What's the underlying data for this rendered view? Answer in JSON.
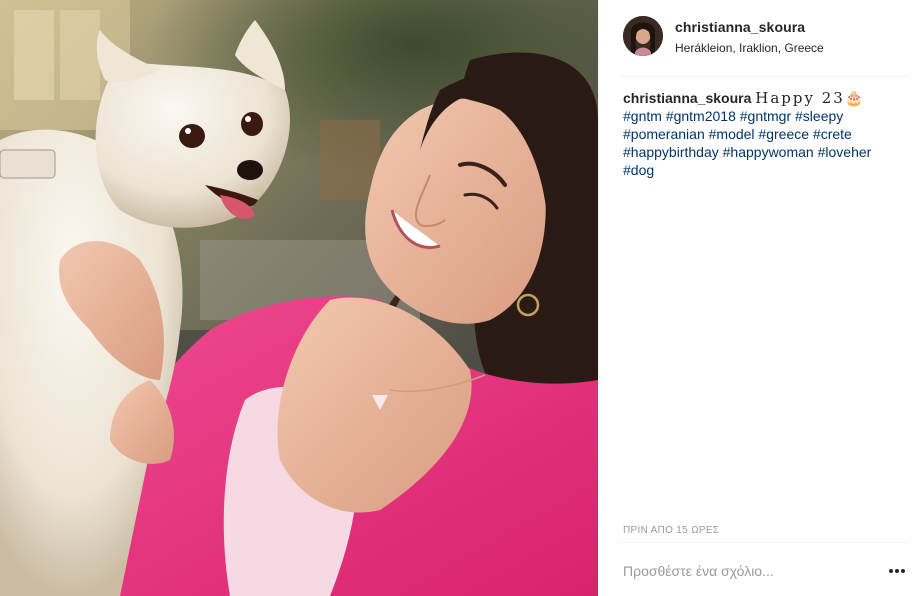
{
  "post": {
    "author": {
      "username": "christianna_skoura",
      "location": "Heráklеion, Iraklion, Greece"
    },
    "caption": {
      "username": "christianna_skoura",
      "text": "Happy 23🎂",
      "hashtags": [
        "#gntm",
        "#gntm2018",
        "#gntmgr",
        "#sleepy",
        "#pomeranian",
        "#model",
        "#greece",
        "#crete",
        "#happybirthday",
        "#happywoman",
        "#loveher",
        "#dog"
      ]
    },
    "timestamp": "ΠΡΙΝ ΑΠΟ 15 ΩΡΕΣ",
    "comment": {
      "placeholder": "Προσθέστε ένα σχόλιο...",
      "value": ""
    },
    "icons": {
      "more": "more-options-icon"
    },
    "colors": {
      "hashtag": "#003569",
      "text": "#262626",
      "muted": "#999999",
      "jacket": "#e8357e"
    }
  }
}
